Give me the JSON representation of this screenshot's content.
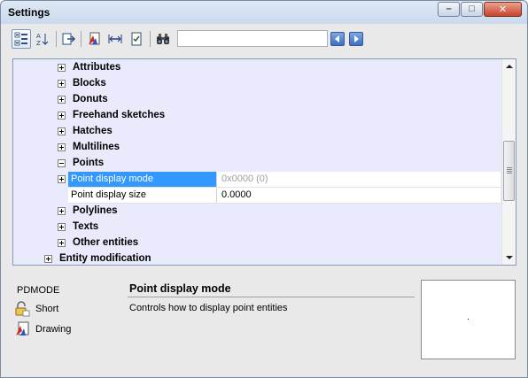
{
  "window": {
    "title": "Settings",
    "caption_buttons": {
      "minimize": "–",
      "maximize": "□",
      "close": "✕"
    }
  },
  "toolbar": {
    "buttons": [
      {
        "name": "categorized-view",
        "icon": "categorized-list-icon",
        "active": true
      },
      {
        "name": "alphabetical-view",
        "icon": "sort-az-icon",
        "active": false
      },
      {
        "name": "export",
        "icon": "export-icon",
        "active": false
      },
      {
        "name": "drawing-scope",
        "icon": "drawing-icon",
        "active": false
      },
      {
        "name": "dimension",
        "icon": "dimension-icon",
        "active": false
      },
      {
        "name": "checklist",
        "icon": "checklist-icon",
        "active": false
      },
      {
        "name": "find",
        "icon": "binoculars-icon",
        "active": false
      }
    ],
    "search": {
      "value": "",
      "placeholder": ""
    },
    "nav": {
      "back_icon": "arrow-left-icon",
      "forward_icon": "arrow-right-icon"
    }
  },
  "tree": {
    "items": [
      {
        "label": "Attributes",
        "expanded": false
      },
      {
        "label": "Blocks",
        "expanded": false
      },
      {
        "label": "Donuts",
        "expanded": false
      },
      {
        "label": "Freehand sketches",
        "expanded": false
      },
      {
        "label": "Hatches",
        "expanded": false
      },
      {
        "label": "Multilines",
        "expanded": false
      },
      {
        "label": "Points",
        "expanded": true
      },
      {
        "label": "Polylines",
        "expanded": false
      },
      {
        "label": "Texts",
        "expanded": false
      },
      {
        "label": "Other entities",
        "expanded": false
      },
      {
        "label": "Entity modification",
        "expanded": false
      }
    ],
    "properties": [
      {
        "name": "Point display mode",
        "value": "0x0000 (0)",
        "selected": true
      },
      {
        "name": "Point display size",
        "value": "0.0000",
        "selected": false
      }
    ]
  },
  "description": {
    "variable": "PDMODE",
    "scope_label": "Short",
    "scope_icon": "lock-icon",
    "storage_label": "Drawing",
    "storage_icon": "drawing-icon",
    "title": "Point display mode",
    "text": "Controls how to display point entities"
  },
  "colors": {
    "selection": "#3399ff",
    "tree_background": "#eaeafd",
    "window_frame": "#7c8ba0"
  }
}
